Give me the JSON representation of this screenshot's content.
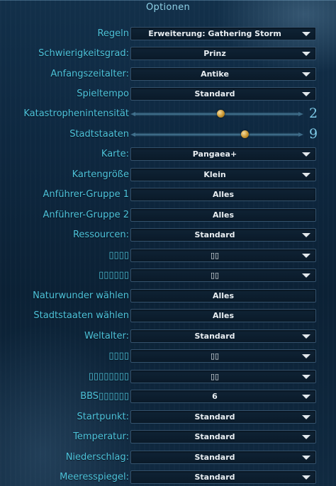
{
  "header": {
    "title": "Optionen"
  },
  "options": [
    {
      "key": "regeln",
      "label": "Regeln",
      "type": "dropdown",
      "value": "Erweiterung: Gathering Storm"
    },
    {
      "key": "schwierigkeit",
      "label": "Schwierigkeitsgrad:",
      "type": "dropdown",
      "value": "Prinz"
    },
    {
      "key": "anfangszeitalter",
      "label": "Anfangszeitalter:",
      "type": "dropdown",
      "value": "Antike"
    },
    {
      "key": "spieltempo",
      "label": "Spieltempo",
      "type": "dropdown",
      "value": "Standard"
    },
    {
      "key": "katastrophen",
      "label": "Katastrophenintensität",
      "type": "slider",
      "value": "2",
      "level": 0.52
    },
    {
      "key": "stadtstaaten",
      "label": "Stadtstaaten",
      "type": "slider",
      "value": "9",
      "level": 0.67
    },
    {
      "key": "karte",
      "label": "Karte:",
      "type": "dropdown",
      "value": "Pangaea+"
    },
    {
      "key": "kartengroesse",
      "label": "Kartengröße",
      "type": "dropdown",
      "value": "Klein"
    },
    {
      "key": "anfuehrer1",
      "label": "Anführer-Gruppe 1",
      "type": "field",
      "value": "Alles"
    },
    {
      "key": "anfuehrer2",
      "label": "Anführer-Gruppe 2",
      "type": "field",
      "value": "Alles"
    },
    {
      "key": "ressourcen",
      "label": "Ressourcen:",
      "type": "dropdown",
      "value": "Standard"
    },
    {
      "key": "unk1",
      "label": "▯▯▯▯",
      "type": "dropdown",
      "value": "▯▯"
    },
    {
      "key": "unk2",
      "label": "▯▯▯▯▯▯",
      "type": "dropdown",
      "value": "▯▯"
    },
    {
      "key": "naturwunder",
      "label": "Naturwunder wählen",
      "type": "field",
      "value": "Alles"
    },
    {
      "key": "stadtstaaten_waehlen",
      "label": "Stadtstaaten wählen",
      "type": "field",
      "value": "Alles"
    },
    {
      "key": "weltalter",
      "label": "Weltalter:",
      "type": "dropdown",
      "value": "Standard"
    },
    {
      "key": "unk3",
      "label": "▯▯▯▯",
      "type": "dropdown",
      "value": "▯▯"
    },
    {
      "key": "unk4",
      "label": "▯▯▯▯▯▯▯▯",
      "type": "dropdown",
      "value": "▯▯"
    },
    {
      "key": "bbs",
      "label": "BBS▯▯▯▯▯▯",
      "type": "dropdown",
      "value": "6"
    },
    {
      "key": "startpunkt",
      "label": "Startpunkt:",
      "type": "dropdown",
      "value": "Standard"
    },
    {
      "key": "temperatur",
      "label": "Temperatur:",
      "type": "dropdown",
      "value": "Standard"
    },
    {
      "key": "niederschlag",
      "label": "Niederschlag:",
      "type": "dropdown",
      "value": "Standard"
    },
    {
      "key": "meeresspiegel",
      "label": "Meeresspiegel:",
      "type": "dropdown",
      "value": "Standard"
    }
  ]
}
